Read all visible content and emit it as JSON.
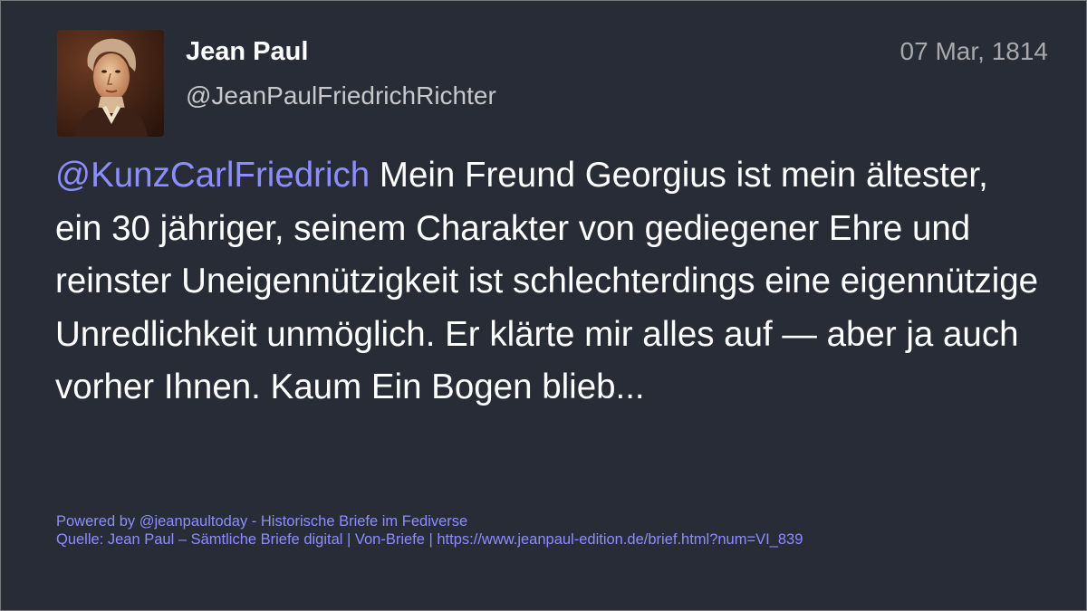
{
  "post": {
    "display_name": "Jean Paul",
    "handle": "@JeanPaulFriedrichRichter",
    "date": "07 Mar, 1814",
    "mention": "@KunzCarlFriedrich",
    "text": " Mein Freund Georgius ist mein ältester, ein 30 jähriger, seinem Charakter von gediegener Ehre und reinster Uneigennützigkeit ist schlechterdings eine eigennützige Unredlichkeit unmöglich. Er klärte mir alles auf — aber ja auch vorher Ihnen. Kaum Ein Bogen blieb..."
  },
  "footer": {
    "powered_by": "Powered by @jeanpaultoday - Historische Briefe im Fediverse",
    "source": "Quelle: Jean Paul – Sämtliche Briefe digital | Von-Briefe | https://www.jeanpaul-edition.de/brief.html?num=VI_839"
  },
  "colors": {
    "background": "#282c37",
    "mention": "#8c8dff",
    "text": "#ffffff",
    "secondary": "#c7c7cc"
  }
}
